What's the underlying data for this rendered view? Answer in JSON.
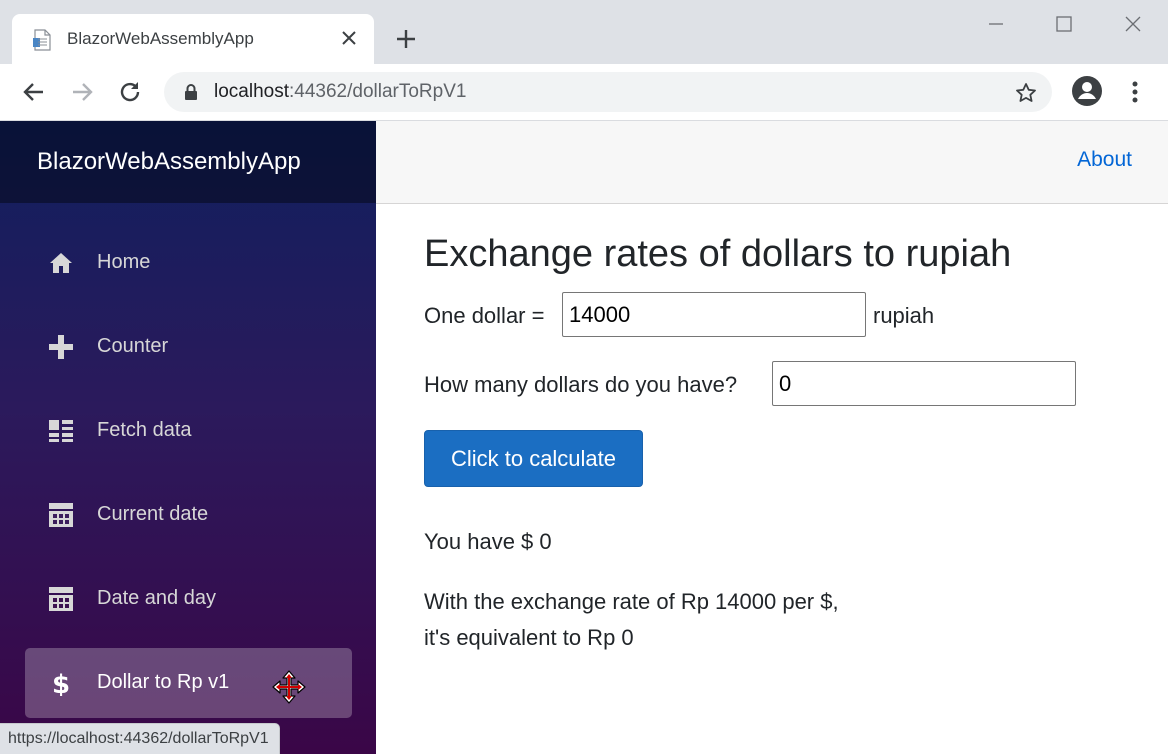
{
  "browser": {
    "tab_title": "BlazorWebAssemblyApp",
    "url_host": "localhost",
    "url_path": ":44362/dollarToRpV1",
    "status_url": "https://localhost:44362/dollarToRpV1"
  },
  "app": {
    "brand": "BlazorWebAssemblyApp",
    "about_link": "About",
    "nav": [
      {
        "label": "Home",
        "icon": "home-icon"
      },
      {
        "label": "Counter",
        "icon": "plus-icon"
      },
      {
        "label": "Fetch data",
        "icon": "list-icon"
      },
      {
        "label": "Current date",
        "icon": "calendar-icon"
      },
      {
        "label": "Date and day",
        "icon": "calendar-icon"
      },
      {
        "label": "Dollar to Rp v1",
        "icon": "dollar-icon",
        "active": true
      }
    ]
  },
  "page": {
    "title": "Exchange rates of dollars to rupiah",
    "rate_label": "One dollar =",
    "rate_value": "14000",
    "rate_unit": "rupiah",
    "dollars_label": "How many dollars do you have?",
    "dollars_value": "0",
    "calculate_button": "Click to calculate",
    "result_have": "You have $ 0",
    "result_rate_line": "With the exchange rate of Rp 14000 per $,",
    "result_equivalent": "it's equivalent to Rp 0"
  },
  "colors": {
    "primary_button": "#1b6ec2",
    "link": "#0366d6",
    "sidebar_top": "#0f1f5e",
    "sidebar_bottom": "#3a0647"
  }
}
